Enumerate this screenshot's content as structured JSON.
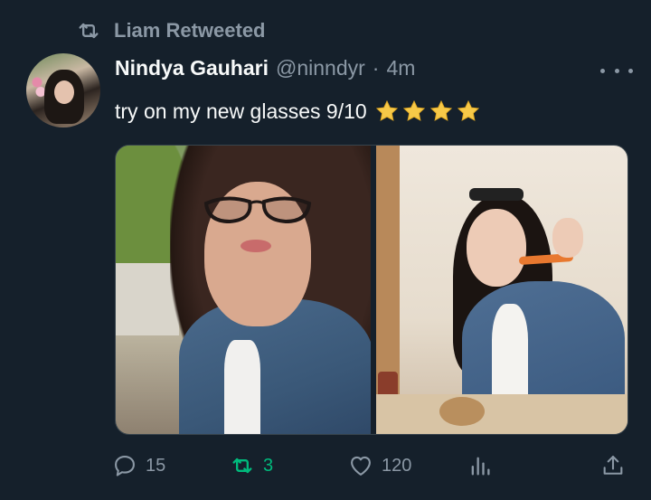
{
  "retweet_banner": {
    "text": "Liam Retweeted"
  },
  "tweet": {
    "author": {
      "display_name": "Nindya Gauhari",
      "handle": "@ninndyr",
      "separator": "·",
      "time": "4m"
    },
    "text": "try on my new glasses 9/10",
    "rating_stars": 4,
    "media": {
      "count": 2
    }
  },
  "actions": {
    "reply_count": "15",
    "retweet_count": "3",
    "like_count": "120"
  },
  "colors": {
    "background": "#15202b",
    "muted": "#8b98a5",
    "text": "#f7f9f9",
    "retweet_active": "#00ba7c",
    "star": "#f7c948"
  }
}
